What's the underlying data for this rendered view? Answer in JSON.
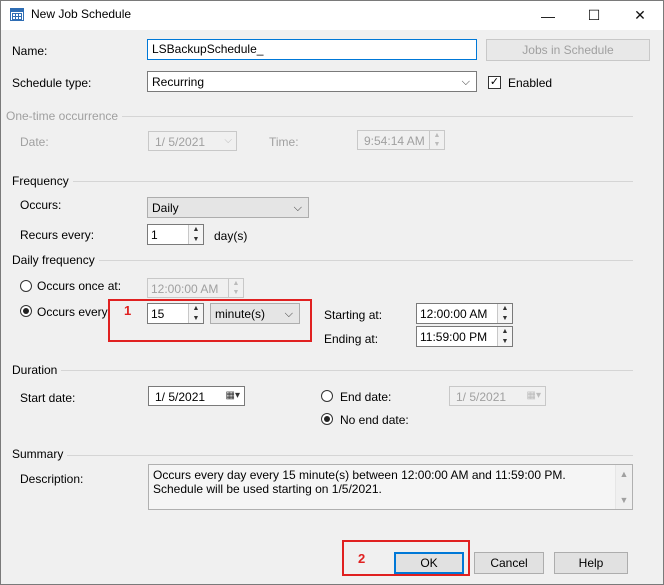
{
  "window": {
    "title": "New Job Schedule",
    "minimize": "—",
    "maximize": "☐",
    "close": "✕"
  },
  "name": {
    "label": "Name:",
    "value": "LSBackupSchedule_"
  },
  "jobs_button": "Jobs in Schedule",
  "schedule_type": {
    "label": "Schedule type:",
    "value": "Recurring"
  },
  "enabled": {
    "label": "Enabled",
    "checked": true
  },
  "one_time": {
    "section": "One-time occurrence",
    "date_label": "Date:",
    "date_value": "1/  5/2021",
    "time_label": "Time:",
    "time_value": "9:54:14 AM"
  },
  "frequency": {
    "section": "Frequency",
    "occurs_label": "Occurs:",
    "occurs_value": "Daily",
    "recurs_label": "Recurs every:",
    "recurs_value": "1",
    "recurs_unit": "day(s)"
  },
  "daily": {
    "section": "Daily frequency",
    "once_label": "Occurs once at:",
    "once_value": "12:00:00 AM",
    "every_label": "Occurs every:",
    "every_value": "15",
    "every_unit": "minute(s)",
    "starting_label": "Starting at:",
    "starting_value": "12:00:00 AM",
    "ending_label": "Ending at:",
    "ending_value": "11:59:00 PM"
  },
  "duration": {
    "section": "Duration",
    "start_label": "Start date:",
    "start_value": "1/  5/2021",
    "end_label": "End date:",
    "end_value": "1/  5/2021",
    "no_end_label": "No end date:"
  },
  "summary": {
    "section": "Summary",
    "desc_label": "Description:",
    "text": "Occurs every day every 15 minute(s) between 12:00:00 AM and 11:59:00 PM. Schedule will be used starting on 1/5/2021."
  },
  "buttons": {
    "ok": "OK",
    "cancel": "Cancel",
    "help": "Help"
  },
  "annotations": {
    "one": "1",
    "two": "2"
  },
  "colors": {
    "annotation": "#e02020",
    "accent": "#0078d7",
    "window_bg": "#f0f0f0"
  }
}
